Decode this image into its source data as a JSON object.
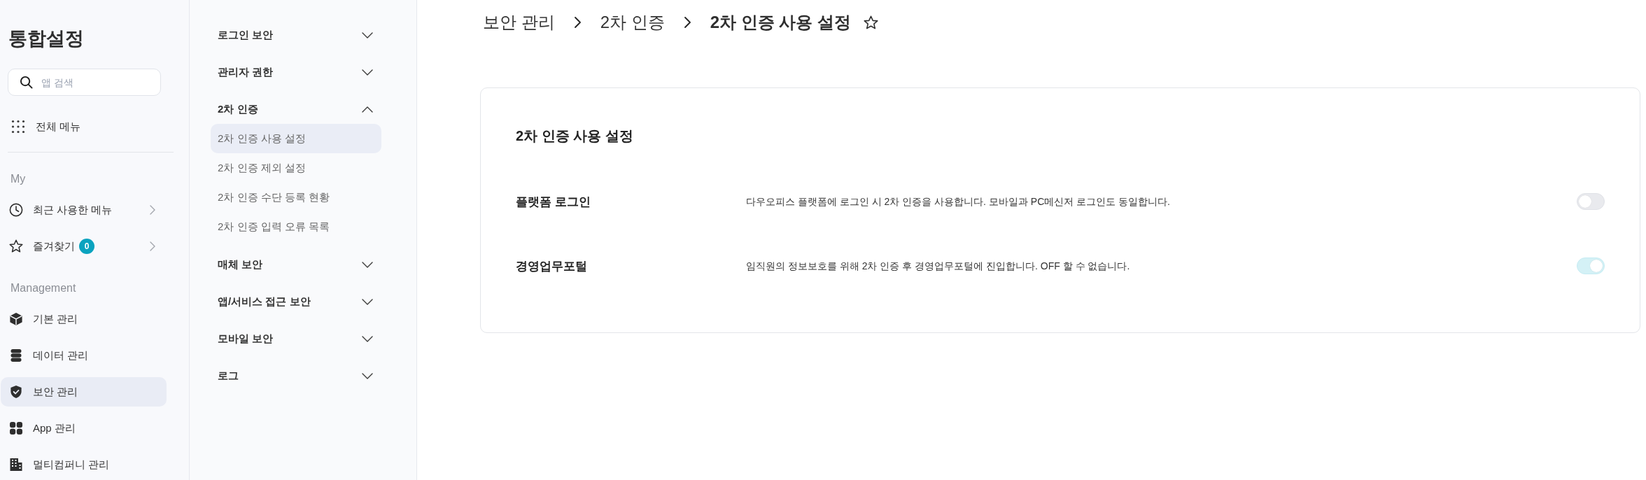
{
  "app_sidebar": {
    "title": "통합설정",
    "search": {
      "placeholder": "앱 검색"
    },
    "all_menu": {
      "label": "전체 메뉴"
    },
    "sections": [
      {
        "kind": "shortcuts",
        "heading": "My",
        "items": [
          {
            "label": "최근 사용한 메뉴",
            "selected": false
          },
          {
            "label": "즐겨찾기",
            "badge": "0",
            "selected": false
          }
        ]
      },
      {
        "kind": "apps",
        "heading": "Management",
        "items": [
          {
            "label": "기본 관리",
            "selected": false
          },
          {
            "label": "데이터 관리",
            "selected": false
          },
          {
            "label": "보안 관리",
            "selected": true
          },
          {
            "label": "App 관리",
            "selected": false
          },
          {
            "label": "멀티컴퍼니 관리",
            "selected": false
          }
        ]
      }
    ]
  },
  "submenu": {
    "groups": [
      {
        "label": "로그인 보안",
        "expanded": false
      },
      {
        "label": "관리자 권한",
        "expanded": false
      },
      {
        "label": "2차 인증",
        "expanded": true,
        "children": [
          {
            "label": "2차 인증 사용 설정",
            "selected": true
          },
          {
            "label": "2차 인증 제외 설정",
            "selected": false
          },
          {
            "label": "2차 인증 수단 등록 현황",
            "selected": false
          },
          {
            "label": "2차 인증 입력 오류 목록",
            "selected": false
          }
        ]
      },
      {
        "label": "매체 보안",
        "expanded": false
      },
      {
        "label": "앱/서비스 접근 보안",
        "expanded": false
      },
      {
        "label": "모바일 보안",
        "expanded": false
      },
      {
        "label": "로그",
        "expanded": false
      }
    ]
  },
  "breadcrumb": {
    "items": [
      "보안 관리",
      "2차 인증",
      "2차 인증 사용 설정"
    ],
    "favorited": false
  },
  "settings_card": {
    "title": "2차 인증 사용 설정",
    "rows": [
      {
        "label": "플랫폼 로그인",
        "description": "다우오피스 플랫폼에 로그인 시 2차 인증을 사용합니다. 모바일과 PC메신저 로그인도 동일합니다.",
        "on": false,
        "disabled": false
      },
      {
        "label": "경영업무포털",
        "description": "임직원의 정보보호를 위해 2차 인증 후 경영업무포털에 진입합니다. OFF 할 수 없습니다.",
        "on": true,
        "disabled": true
      }
    ]
  }
}
